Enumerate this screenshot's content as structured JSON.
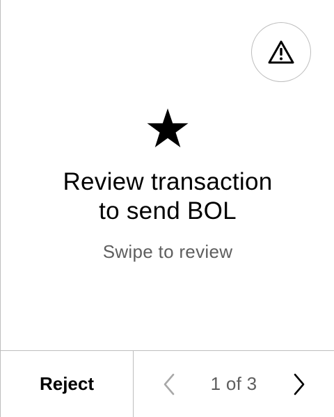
{
  "warning_button": {
    "icon": "warning-triangle-icon"
  },
  "hero": {
    "icon": "star-icon",
    "title_line1": "Review transaction",
    "title_line2": "to send BOL",
    "subtitle": "Swipe to review"
  },
  "footer": {
    "reject_label": "Reject",
    "prev_icon": "chevron-left-icon",
    "next_icon": "chevron-right-icon",
    "page_indicator": "1 of 3"
  },
  "colors": {
    "background": "#ffffff",
    "text": "#000000",
    "muted_text": "#5e5e5e",
    "divider": "#bdbdbd",
    "disabled_icon": "#a8a8a8"
  }
}
